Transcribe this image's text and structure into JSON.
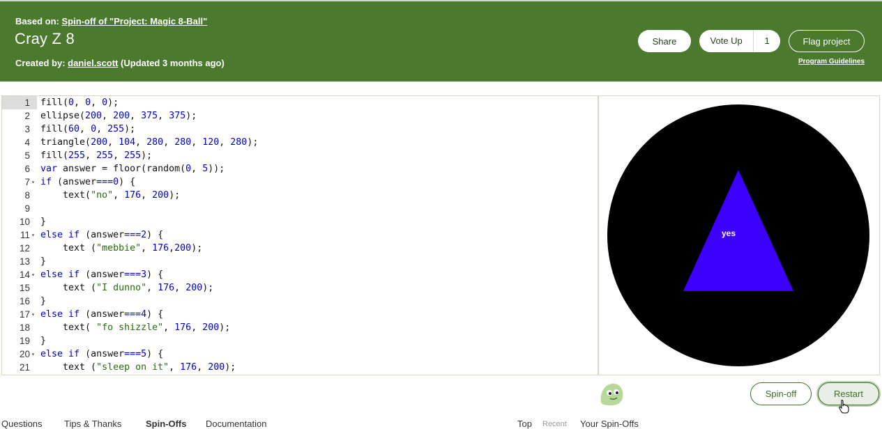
{
  "header": {
    "based_prefix": "Based on:",
    "based_link": "Spin-off of \"Project: Magic 8-Ball\"",
    "title": "Cray Z 8",
    "created_prefix": "Created by:",
    "created_author": "daniel.scott",
    "updated": "(Updated 3 months ago)",
    "share_label": "Share",
    "vote_label": "Vote Up",
    "vote_count": "1",
    "flag_label": "Flag project",
    "guidelines_label": "Program Guidelines"
  },
  "editor": {
    "active_line": 1,
    "lines": [
      {
        "num": "1",
        "fold": false,
        "code": "fill(0, 0, 0);"
      },
      {
        "num": "2",
        "fold": false,
        "code": "ellipse(200, 200, 375, 375);"
      },
      {
        "num": "3",
        "fold": false,
        "code": "fill(60, 0, 255);"
      },
      {
        "num": "4",
        "fold": false,
        "code": "triangle(200, 104, 280, 280, 120, 280);"
      },
      {
        "num": "5",
        "fold": false,
        "code": "fill(255, 255, 255);"
      },
      {
        "num": "6",
        "fold": false,
        "code": "var answer = floor(random(0, 5));"
      },
      {
        "num": "7",
        "fold": true,
        "code": "if (answer===0) {"
      },
      {
        "num": "8",
        "fold": false,
        "code": "    text(\"no\", 176, 200);"
      },
      {
        "num": "9",
        "fold": false,
        "code": ""
      },
      {
        "num": "10",
        "fold": false,
        "code": "}"
      },
      {
        "num": "11",
        "fold": true,
        "code": "else if (answer===2) {"
      },
      {
        "num": "12",
        "fold": false,
        "code": "    text (\"mebbie\", 176,200);"
      },
      {
        "num": "13",
        "fold": false,
        "code": "}"
      },
      {
        "num": "14",
        "fold": true,
        "code": "else if (answer===3) {"
      },
      {
        "num": "15",
        "fold": false,
        "code": "    text (\"I dunno\", 176, 200);"
      },
      {
        "num": "16",
        "fold": false,
        "code": "}"
      },
      {
        "num": "17",
        "fold": true,
        "code": "else if (answer===4) {"
      },
      {
        "num": "18",
        "fold": false,
        "code": "    text( \"fo shizzle\", 176, 200);"
      },
      {
        "num": "19",
        "fold": false,
        "code": "}"
      },
      {
        "num": "20",
        "fold": true,
        "code": "else if (answer===5) {"
      },
      {
        "num": "21",
        "fold": false,
        "code": "    text (\"sleep on it\", 176, 200);"
      }
    ]
  },
  "output": {
    "answer_text": "yes",
    "ball_color": "#000000",
    "triangle_color": "#3c00ff",
    "text_color": "#ffffff"
  },
  "actions": {
    "spinoff_label": "Spin-off",
    "restart_label": "Restart"
  },
  "tabs": {
    "left": [
      "Questions",
      "Tips & Thanks",
      "Spin-Offs",
      "Documentation"
    ],
    "active": "Spin-Offs",
    "sort_top": "Top",
    "sort_recent": "Recent",
    "your_spinoffs": "Your Spin-Offs"
  },
  "colors": {
    "header_bg": "#4b7a2e",
    "accent": "#3e6b27"
  }
}
